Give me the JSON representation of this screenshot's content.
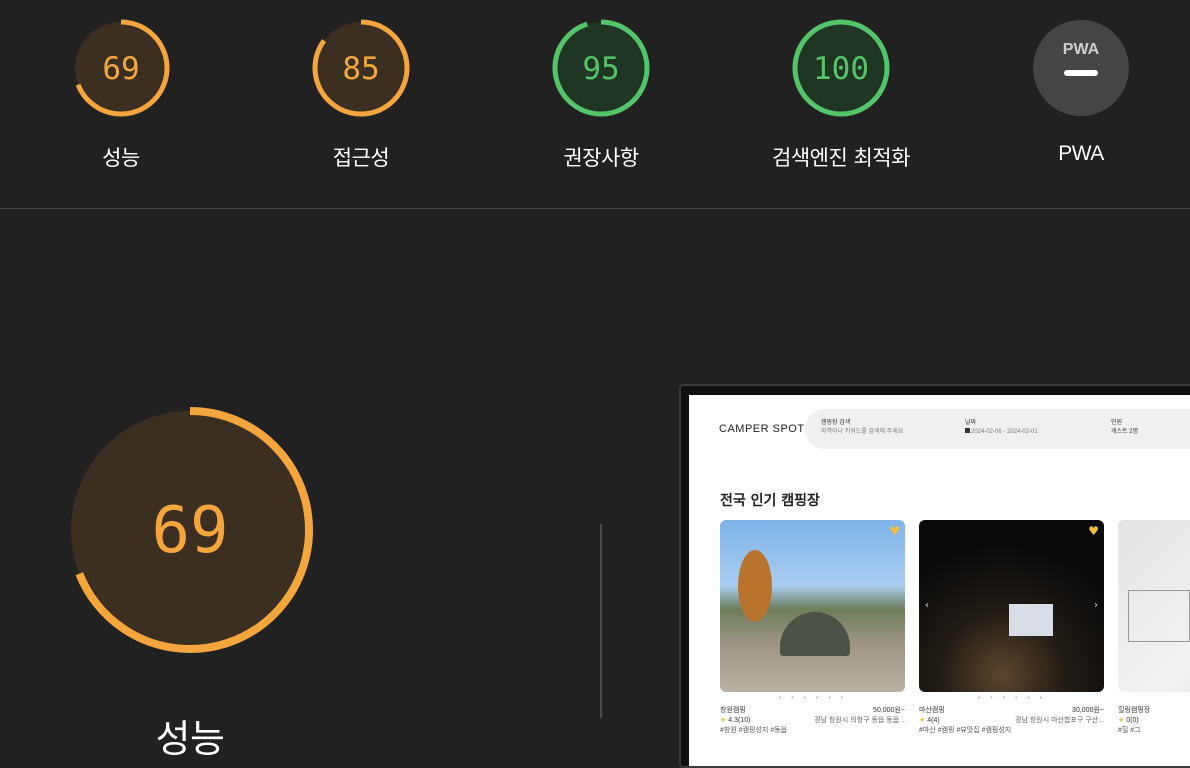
{
  "colors": {
    "orange": "#f4a53c",
    "orange_bg": "#3b2f22",
    "green": "#53c46a",
    "green_bg": "#203524",
    "gray_bg": "#454545",
    "track": "#212121"
  },
  "summary_gauges": [
    {
      "label": "성능",
      "score": "69",
      "value": 69,
      "color": "orange"
    },
    {
      "label": "접근성",
      "score": "85",
      "value": 85,
      "color": "orange"
    },
    {
      "label": "권장사항",
      "score": "95",
      "value": 95,
      "color": "green"
    },
    {
      "label": "검색엔진 최적화",
      "score": "100",
      "value": 100,
      "color": "green"
    },
    {
      "label": "PWA",
      "badge": "PWA",
      "icon": "pwa-dash-icon"
    }
  ],
  "performance": {
    "label": "성능",
    "score": "69",
    "value": 69
  },
  "screenshot": {
    "logo": "CAMPER SPOT",
    "search": [
      {
        "label": "캠핑장 검색",
        "value": "지역이나 키워드를 검색해 주세요"
      },
      {
        "label": "날짜",
        "value": "2024-02-06 - 2024-02-01"
      },
      {
        "label": "인원",
        "value": "게스트 2명"
      }
    ],
    "section_title": "전국 인기 캠핑장",
    "cards": [
      {
        "name": "창원캠핑",
        "rating": "4.3(10)",
        "price": "50,000원~",
        "address": "경남 창원시 의창구 동읍 동읍...",
        "tags": "#창원 #캠핑성지 #동읍"
      },
      {
        "name": "마산캠핑",
        "rating": "4(4)",
        "price": "30,000원~",
        "address": "경남 창원시 마산합포구 구산...",
        "tags": "#마산 #캠핑 #뷰맛집 #캠핑성지"
      },
      {
        "name": "힐링캠핑장",
        "rating": "0(0)",
        "price": "",
        "address": "",
        "tags": "#힐 #그"
      }
    ]
  }
}
